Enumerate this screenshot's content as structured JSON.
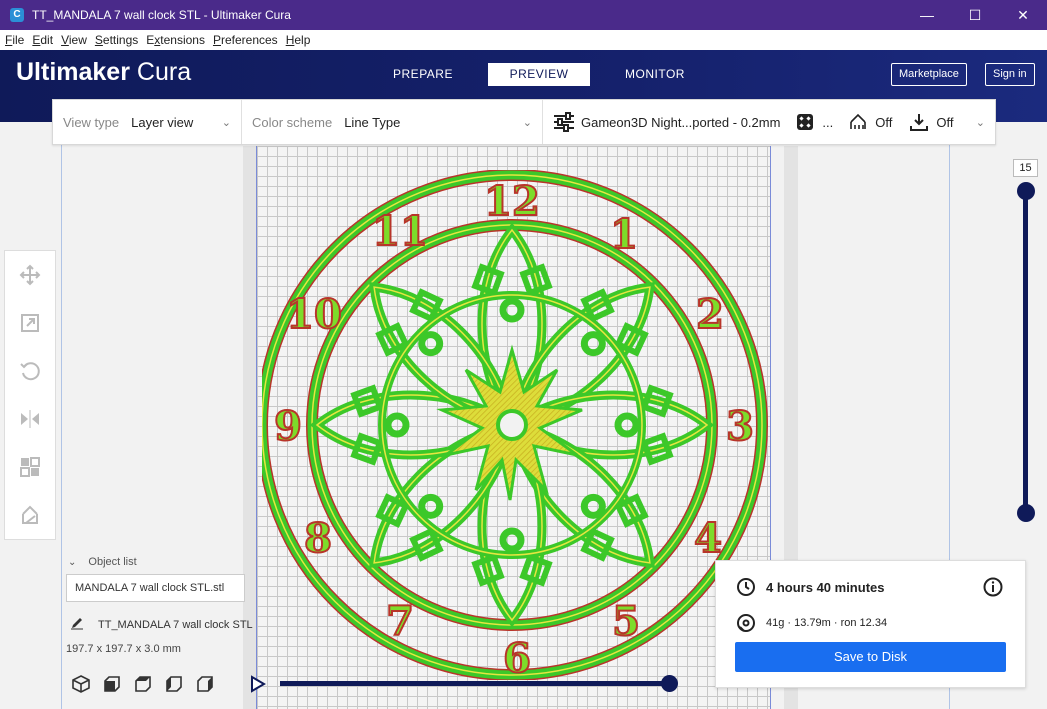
{
  "window": {
    "title": "TT_MANDALA 7 wall clock STL - Ultimaker Cura",
    "app_icon": "cura-app-icon",
    "minimize": "—",
    "maximize": "☐",
    "close": "✕"
  },
  "menu": [
    {
      "pre": "",
      "u": "F",
      "post": "ile"
    },
    {
      "pre": "",
      "u": "E",
      "post": "dit"
    },
    {
      "pre": "",
      "u": "V",
      "post": "iew"
    },
    {
      "pre": "",
      "u": "S",
      "post": "ettings"
    },
    {
      "pre": "E",
      "u": "x",
      "post": "tensions"
    },
    {
      "pre": "",
      "u": "P",
      "post": "references"
    },
    {
      "pre": "",
      "u": "H",
      "post": "elp"
    }
  ],
  "header": {
    "brand_bold": "Ultimaker",
    "brand_light": "Cura",
    "tabs": [
      "PREPARE",
      "PREVIEW",
      "MONITOR"
    ],
    "active_tab": "PREVIEW",
    "marketplace": "Marketplace",
    "signin": "Sign in"
  },
  "viewbar": {
    "view_type_label": "View type",
    "view_type_value": "Layer view",
    "color_scheme_label": "Color scheme",
    "color_scheme_value": "Line Type",
    "profile": "Gameon3D Night...ported - 0.2mm",
    "infill_ellipsis": "...",
    "support": "Off",
    "adhesion": "Off"
  },
  "object_list": {
    "title": "Object list",
    "file": "MANDALA 7 wall clock STL.stl",
    "name": "TT_MANDALA 7 wall clock STL",
    "dimensions": "197.7 x 197.7 x 3.0 mm"
  },
  "layer": {
    "current": "15"
  },
  "print_info": {
    "time": "4 hours 40 minutes",
    "material": "41g · 13.79m · ron 12.34",
    "save_button": "Save to Disk"
  },
  "clock_numbers": [
    "12",
    "1",
    "2",
    "3",
    "4",
    "5",
    "6",
    "7",
    "8",
    "9",
    "10",
    "11"
  ],
  "colors": {
    "header_bg": "#0f1a59",
    "accent_blue": "#196ef0",
    "print_green": "#3cc829",
    "print_yellow": "#e6e640",
    "print_red": "#b8352a",
    "titlebar": "#4a2a8a"
  }
}
